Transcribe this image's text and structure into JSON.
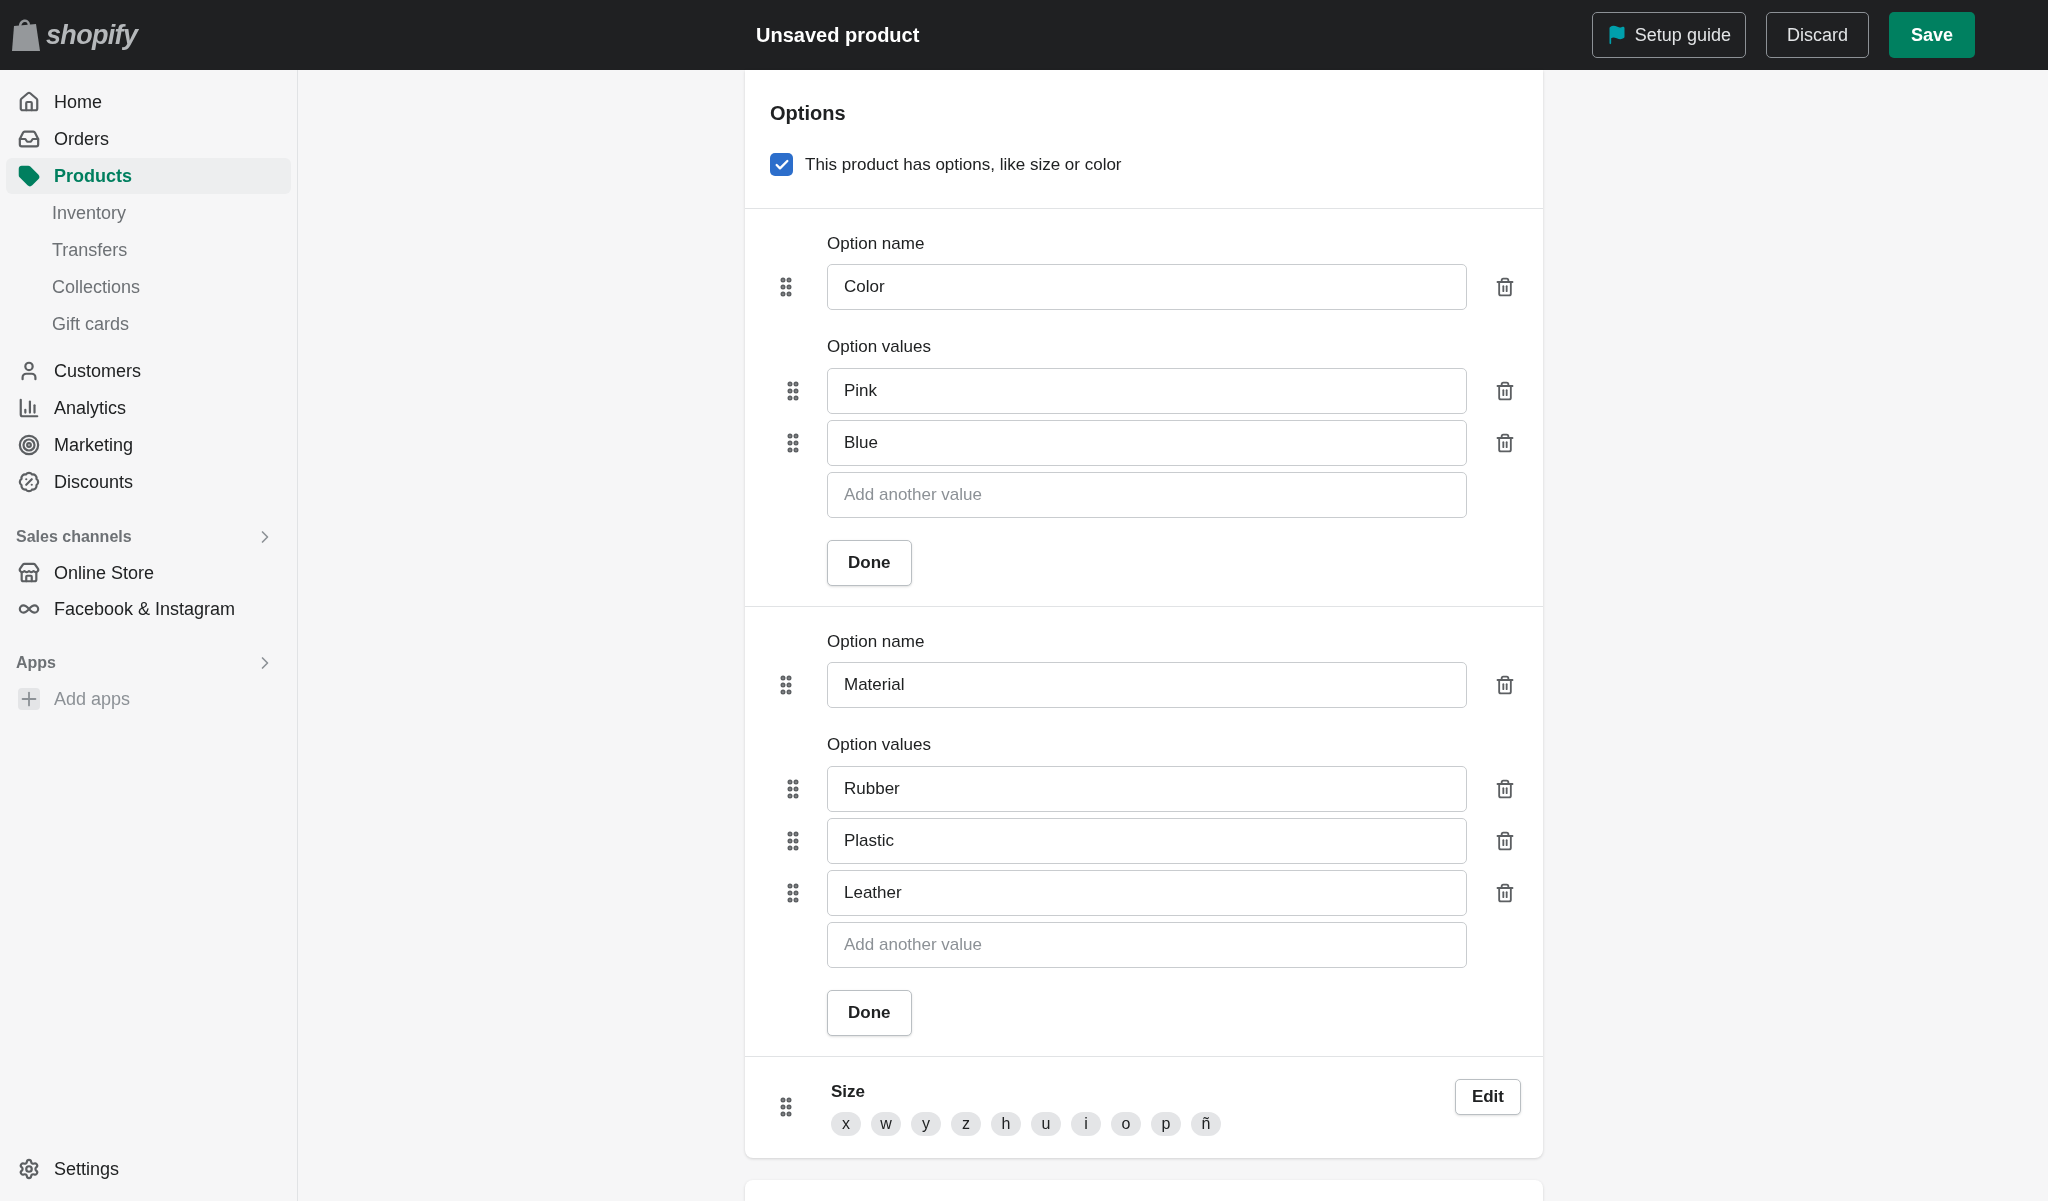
{
  "topbar": {
    "logo": "shopify",
    "title": "Unsaved product",
    "buttons": [
      {
        "label": "Setup guide",
        "kind": "guide"
      },
      {
        "label": "Discard",
        "kind": "secondary"
      },
      {
        "label": "Save",
        "kind": "primary"
      }
    ]
  },
  "sidebar": {
    "items": [
      {
        "label": "Home",
        "selected": false
      },
      {
        "label": "Orders",
        "selected": false
      },
      {
        "label": "Products",
        "selected": true,
        "children": [
          {
            "label": "Inventory",
            "selected": false
          },
          {
            "label": "Transfers",
            "selected": false
          },
          {
            "label": "Collections",
            "selected": false
          },
          {
            "label": "Gift cards",
            "selected": false
          }
        ]
      },
      {
        "label": "Customers",
        "selected": false
      },
      {
        "label": "Analytics",
        "selected": false
      },
      {
        "label": "Marketing",
        "selected": false
      },
      {
        "label": "Discounts",
        "selected": false
      }
    ],
    "sales_channels": {
      "title": "Sales channels",
      "items": [
        {
          "label": "Online Store"
        },
        {
          "label": "Facebook & Instagram"
        }
      ]
    },
    "apps": {
      "title": "Apps",
      "items": [
        {
          "label": "Add apps"
        }
      ]
    },
    "settings": "Settings"
  },
  "options_card": {
    "title": "Options",
    "has_options": {
      "label": "This product has options, like size or color",
      "checked": true
    },
    "options": [
      {
        "kind": "editing",
        "name_label": "Option name",
        "name": "Color",
        "values_label": "Option values",
        "values": [
          "Pink",
          "Blue"
        ],
        "add_placeholder": "Add another value",
        "done": "Done"
      },
      {
        "kind": "editing",
        "name_label": "Option name",
        "name": "Material",
        "values_label": "Option values",
        "values": [
          "Rubber",
          "Plastic",
          "Leather"
        ],
        "add_placeholder": "Add another value",
        "done": "Done"
      },
      {
        "kind": "summary",
        "name": "Size",
        "values": [
          "x",
          "w",
          "y",
          "z",
          "h",
          "u",
          "i",
          "o",
          "p",
          "ñ"
        ],
        "edit": "Edit"
      }
    ]
  }
}
